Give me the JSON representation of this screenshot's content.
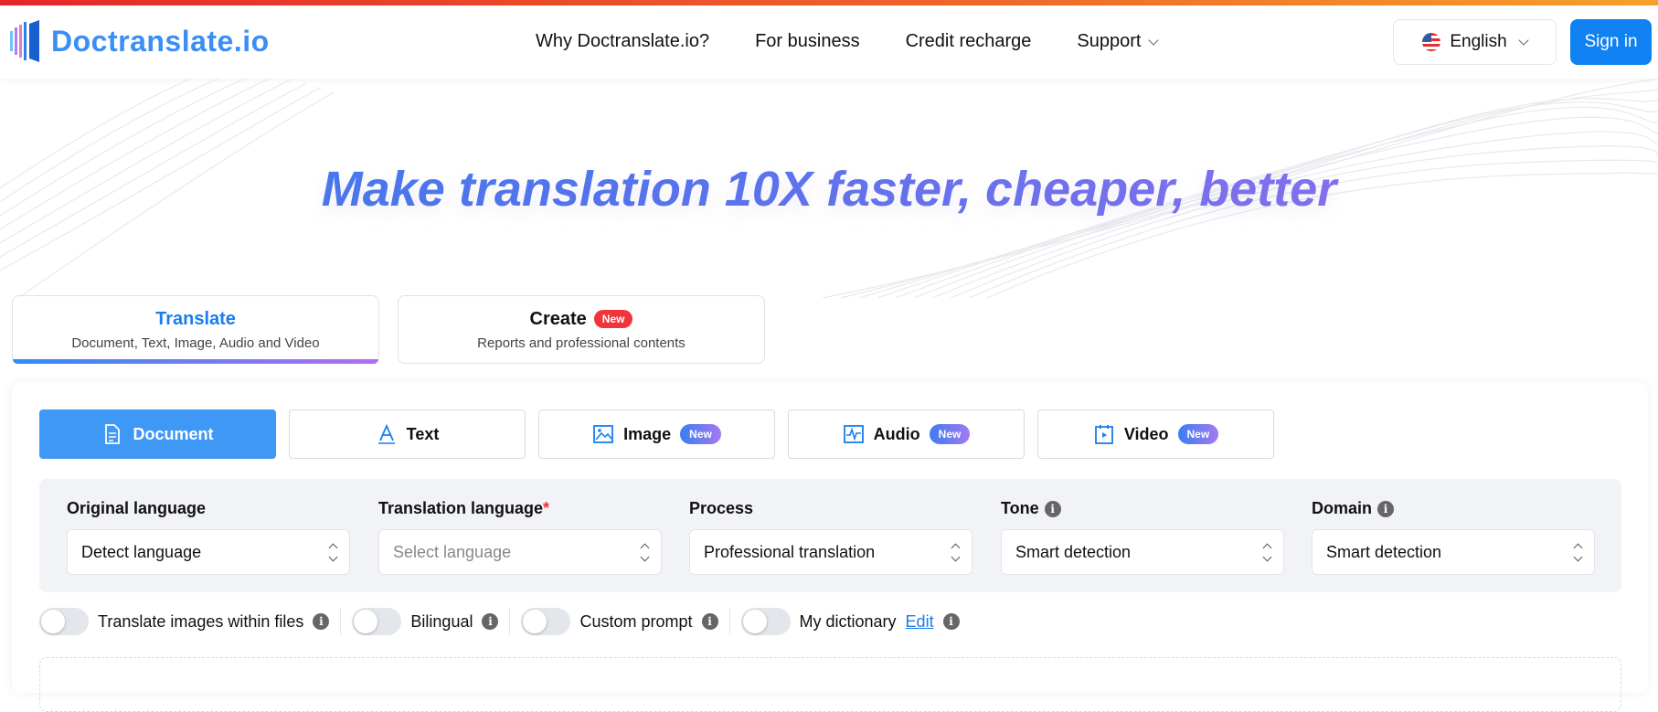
{
  "brand": {
    "name": "Doctranslate.io",
    "accent": "#3b8ef5"
  },
  "nav": {
    "items": [
      "Why Doctranslate.io?",
      "For business",
      "Credit recharge",
      "Support"
    ],
    "language": "English",
    "signin": "Sign in"
  },
  "hero": {
    "title": "Make translation 10X faster, cheaper, better"
  },
  "modes": [
    {
      "title": "Translate",
      "subtitle": "Document, Text, Image, Audio and Video"
    },
    {
      "title": "Create",
      "badge": "New",
      "subtitle": "Reports and professional contents"
    }
  ],
  "types": [
    {
      "label": "Document",
      "icon": "document-icon"
    },
    {
      "label": "Text",
      "icon": "text-icon"
    },
    {
      "label": "Image",
      "icon": "image-icon",
      "badge": "New"
    },
    {
      "label": "Audio",
      "icon": "audio-icon",
      "badge": "New"
    },
    {
      "label": "Video",
      "icon": "video-icon",
      "badge": "New"
    }
  ],
  "fields": [
    {
      "label": "Original language",
      "value": "Detect language"
    },
    {
      "label": "Translation language",
      "required": "*",
      "placeholder": "Select language"
    },
    {
      "label": "Process",
      "value": "Professional translation"
    },
    {
      "label": "Tone",
      "value": "Smart detection"
    },
    {
      "label": "Domain",
      "value": "Smart detection"
    }
  ],
  "toggles": [
    {
      "label": "Translate images within files"
    },
    {
      "label": "Bilingual"
    },
    {
      "label": "Custom prompt"
    },
    {
      "label": "My dictionary",
      "link": "Edit"
    }
  ],
  "colors": {
    "primary": "#1081f2",
    "active_tab": "#3f98f5",
    "badge_red": "#f0353a"
  }
}
